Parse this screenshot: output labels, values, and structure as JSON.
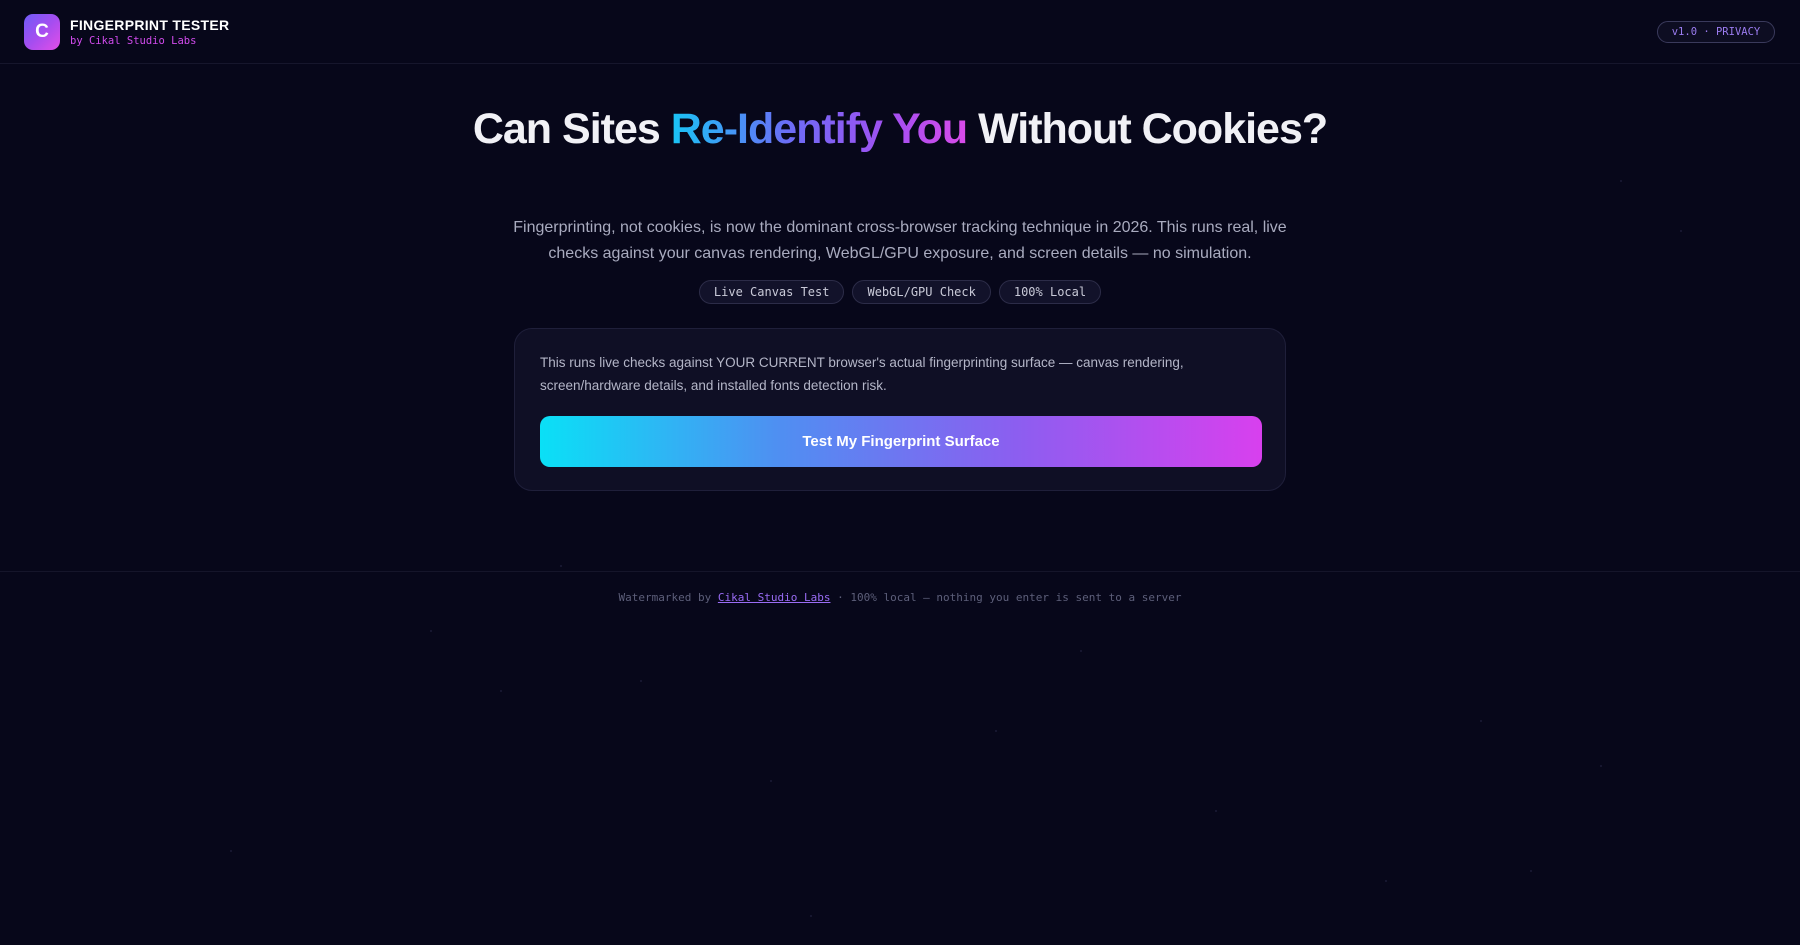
{
  "colors": {
    "background": "#07071a",
    "accent_cyan": "#0ae0f6",
    "accent_purple": "#8c5ef0",
    "accent_magenta": "#d840ee",
    "brand_sub": "#d14bec"
  },
  "header": {
    "logo_letter": "C",
    "title": "FINGERPRINT TESTER",
    "subtitle": "by Cikal Studio Labs",
    "version_badge": "v1.0 · PRIVACY"
  },
  "hero": {
    "headline_part1": "Can Sites ",
    "headline_highlight": "Re-Identify You",
    "headline_part2": " Without Cookies?",
    "subtitle": "Fingerprinting, not cookies, is now the dominant cross-browser tracking technique in 2026. This runs real, live checks against your canvas rendering, WebGL/GPU exposure, and screen details — no simulation.",
    "tags": [
      "Live Canvas Test",
      "WebGL/GPU Check",
      "100% Local"
    ]
  },
  "card": {
    "description": "This runs live checks against YOUR CURRENT browser's actual fingerprinting surface — canvas rendering, screen/hardware details, and installed fonts detection risk.",
    "button_label": "Test My Fingerprint Surface"
  },
  "footer": {
    "prefix": "Watermarked by ",
    "link_text": "Cikal Studio Labs",
    "suffix": " · 100% local — nothing you enter is sent to a server"
  }
}
